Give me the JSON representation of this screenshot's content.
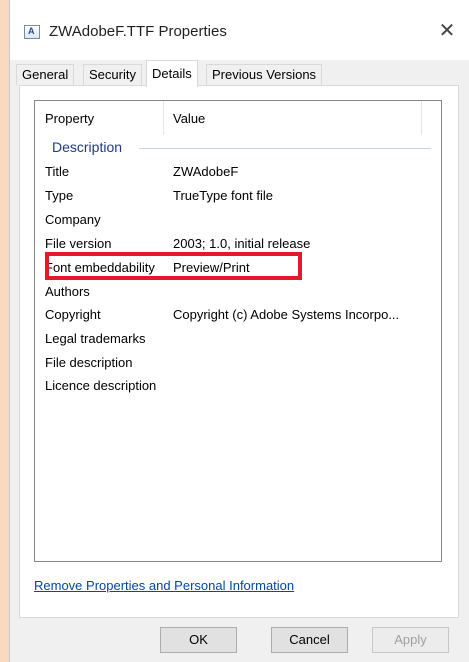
{
  "window": {
    "title": "ZWAdobeF.TTF Properties",
    "close_glyph": "✕"
  },
  "tabs": [
    {
      "label": "General",
      "active": false
    },
    {
      "label": "Security",
      "active": false
    },
    {
      "label": "Details",
      "active": true
    },
    {
      "label": "Previous Versions",
      "active": false
    }
  ],
  "details": {
    "columns": {
      "property": "Property",
      "value": "Value"
    },
    "group": "Description",
    "rows": [
      {
        "key": "Title",
        "value": "ZWAdobeF"
      },
      {
        "key": "Type",
        "value": "TrueType font file"
      },
      {
        "key": "Company",
        "value": ""
      },
      {
        "key": "File version",
        "value": "2003; 1.0, initial release"
      },
      {
        "key": "Font embeddability",
        "value": "Preview/Print"
      },
      {
        "key": "Authors",
        "value": ""
      },
      {
        "key": "Copyright",
        "value": "Copyright (c) Adobe Systems Incorpo..."
      },
      {
        "key": "Legal trademarks",
        "value": ""
      },
      {
        "key": "File description",
        "value": ""
      },
      {
        "key": "Licence description",
        "value": ""
      }
    ]
  },
  "link": "Remove Properties and Personal Information",
  "buttons": {
    "ok": "OK",
    "cancel": "Cancel",
    "apply": "Apply"
  },
  "colors": {
    "highlight": "#e3192a",
    "group_label": "#1e3a8a",
    "link": "#0645ad"
  }
}
